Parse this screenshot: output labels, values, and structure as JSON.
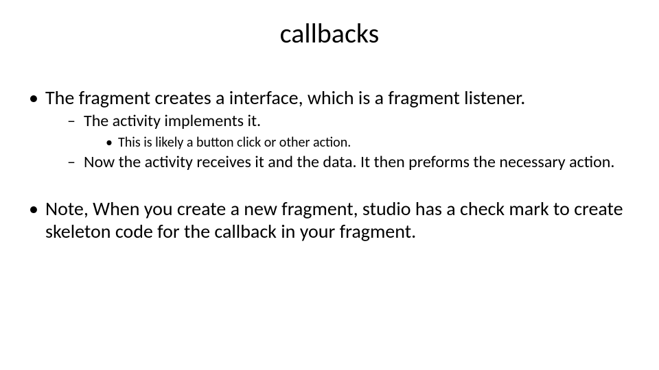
{
  "slide": {
    "title": "callbacks",
    "bullets": {
      "item1": "The fragment creates a interface, which is a fragment listener.",
      "item1_sub1": "The activity implements it.",
      "item1_sub1_sub1": "This is likely a button click or other action.",
      "item1_sub2": "Now the activity receives it and the data.  It then preforms the necessary action.",
      "item2": "Note, When you create a new fragment, studio has a check mark to create skeleton code for the callback in your fragment."
    }
  }
}
